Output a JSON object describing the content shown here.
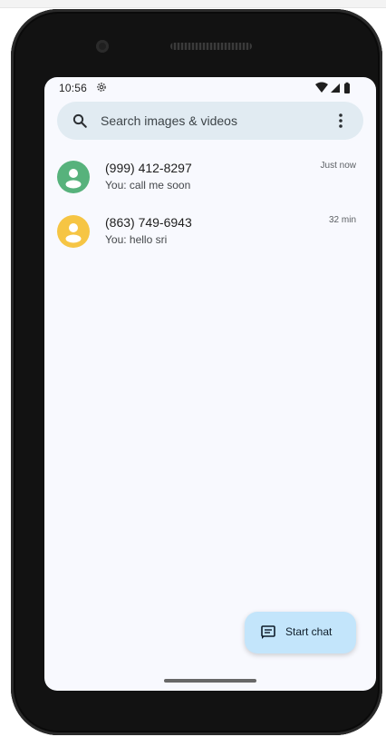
{
  "status_bar": {
    "time": "10:56",
    "settings_icon": "gear-icon",
    "wifi_icon": "wifi-icon",
    "signal_icon": "cellular-signal-icon",
    "battery_icon": "battery-icon"
  },
  "search": {
    "placeholder": "Search images & videos",
    "icon": "search-icon",
    "menu_icon": "more-vertical-icon"
  },
  "conversations": [
    {
      "name": "(999) 412-8297",
      "snippet": "You: call me soon",
      "time": "Just now",
      "avatar_color": "#57b27c",
      "avatar_icon": "person-icon"
    },
    {
      "name": "(863) 749-6943",
      "snippet": "You: hello sri",
      "time": "32 min",
      "avatar_color": "#f6c544",
      "avatar_icon": "person-icon"
    }
  ],
  "fab": {
    "label": "Start chat",
    "icon": "message-icon"
  },
  "colors": {
    "screen_background": "#f8f9fe",
    "search_background": "#e1ebf2",
    "fab_background": "#c3e5fb"
  }
}
